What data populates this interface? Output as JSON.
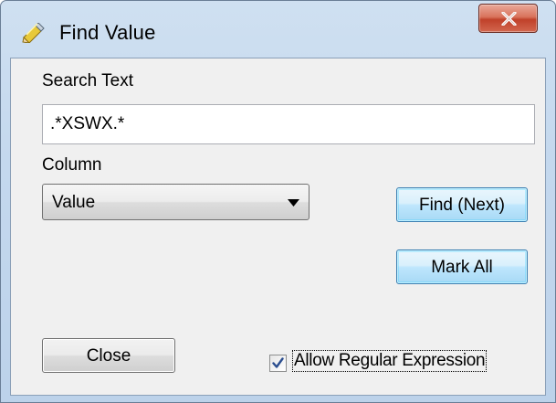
{
  "window": {
    "title": "Find Value",
    "title_icon": "pencil-eraser-icon",
    "close_icon": "close-x-icon"
  },
  "search": {
    "label": "Search Text",
    "value": ".*XSWX.*"
  },
  "column": {
    "label": "Column",
    "selected": "Value"
  },
  "buttons": {
    "find_next": "Find (Next)",
    "mark_all": "Mark All",
    "close": "Close"
  },
  "regex": {
    "label": "Allow Regular Expression",
    "checked": true
  },
  "colors": {
    "title_gradient_top": "#cfe0f1",
    "client_bg": "#f0f0f0",
    "close_red": "#c0412a",
    "default_button_blue": "#bee6fd"
  }
}
